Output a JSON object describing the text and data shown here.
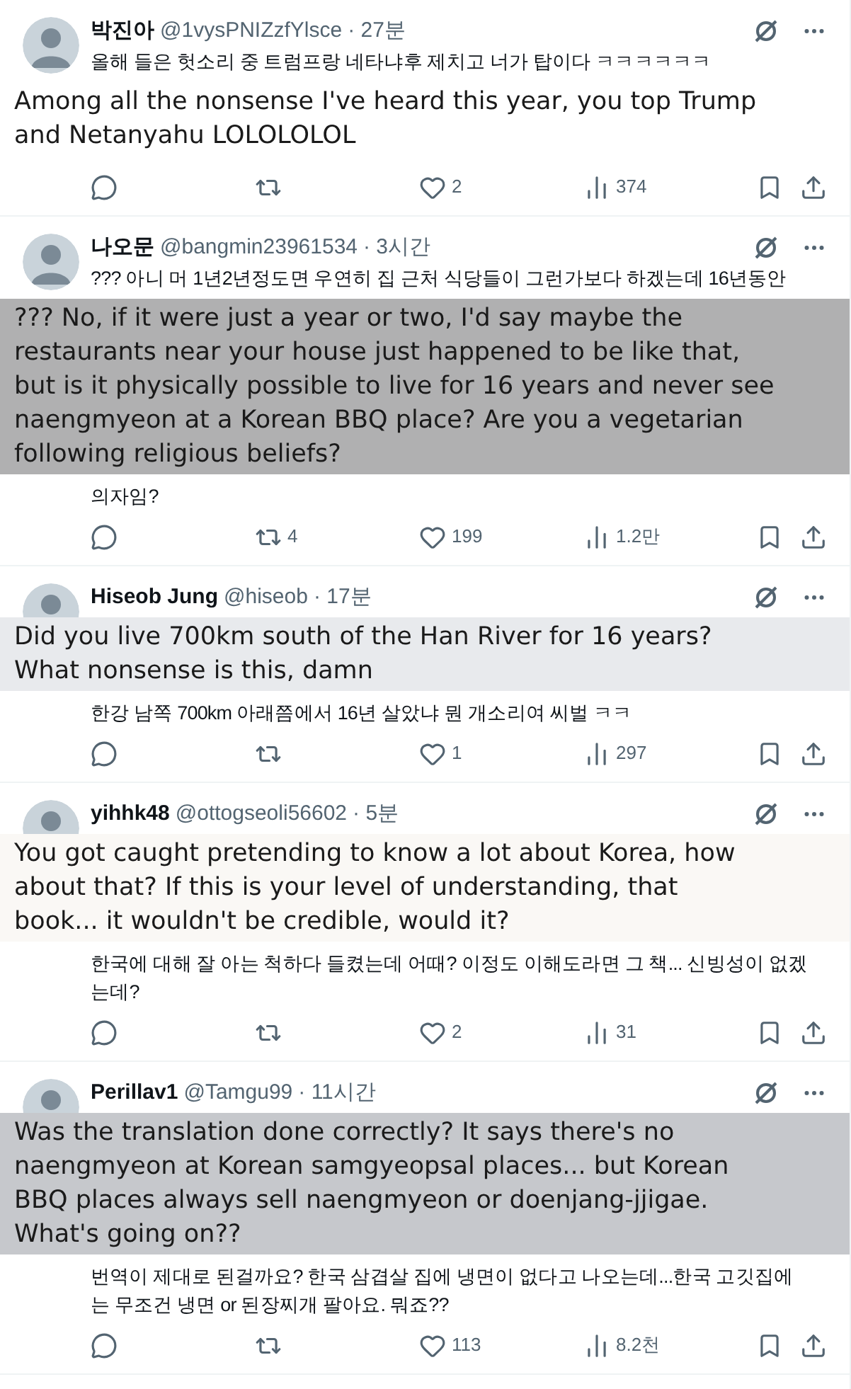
{
  "tweets": [
    {
      "name": "박진아",
      "handle": "@1vysPNIZzfYlsce",
      "time": "· 27분",
      "blocks": [
        {
          "kind": "text",
          "text": "올해 들은 헛소리 중 트럼프랑 네타냐후 제치고 너가 탑이다 ㅋㅋㅋㅋㅋㅋ"
        },
        {
          "kind": "translation",
          "color": "#ffffff",
          "text": "Among all the nonsense I've heard this year, you top Trump\nand Netanyahu LOLOLOLOL"
        }
      ],
      "actions": {
        "likes": "2",
        "views": "374"
      }
    },
    {
      "name": "나오문",
      "handle": "@bangmin23961534",
      "time": "· 3시간",
      "blocks": [
        {
          "kind": "text",
          "text": "??? 아니 머 1년2년정도면 우연히 집 근처 식당들이 그런가보다 하겠는데 16년동안"
        },
        {
          "kind": "translation",
          "color": "#b0b0b1",
          "text": "??? No, if it were just a year or two, I'd say maybe the\nrestaurants near your house just happened to be like that,\nbut is it physically possible to live for 16 years and never see\nnaengmyeon at a Korean BBQ place? Are you a vegetarian\nfollowing religious beliefs?"
        },
        {
          "kind": "text",
          "text": "의자임?"
        }
      ],
      "actions": {
        "reposts": "4",
        "likes": "199",
        "views": "1.2만"
      }
    },
    {
      "name": "Hiseob Jung",
      "handle": "@hiseob",
      "time": "· 17분",
      "blocks": [
        {
          "kind": "translation",
          "color": "#e8eaed",
          "text": "Did you live 700km south of the Han River for 16 years?\nWhat nonsense is this, damn"
        },
        {
          "kind": "text",
          "text": "한강 남쪽 700km 아래쯤에서 16년 살았냐 뭔 개소리여 씨벌 ㅋㅋ"
        }
      ],
      "actions": {
        "likes": "1",
        "views": "297"
      }
    },
    {
      "name": "yihhk48",
      "handle": "@ottogseoli56602",
      "time": "· 5분",
      "blocks": [
        {
          "kind": "translation",
          "color": "#faf8f5",
          "text": "You got caught pretending to know a lot about Korea, how\nabout that? If this is your level of understanding, that\nbook... it wouldn't be credible, would it?"
        },
        {
          "kind": "text",
          "text": "한국에 대해 잘 아는 척하다 들켰는데 어때? 이정도 이해도라면 그 책... 신빙성이 없겠\n는데?"
        }
      ],
      "actions": {
        "likes": "2",
        "views": "31"
      }
    },
    {
      "name": "Perillav1",
      "handle": "@Tamgu99",
      "time": "· 11시간",
      "blocks": [
        {
          "kind": "translation",
          "color": "#c6c8cc",
          "text": "Was the translation done correctly? It says there's no\nnaengmyeon at Korean samgyeopsal places... but Korean\nBBQ places always sell naengmyeon or doenjang-jjigae.\nWhat's going on??"
        },
        {
          "kind": "text",
          "text": "번역이 제대로 된걸까요? 한국 삼겹살 집에 냉면이 없다고 나오는데...한국 고깃집에\n는 무조건 냉면 or 된장찌개 팔아요. 뭐죠??"
        }
      ],
      "actions": {
        "likes": "113",
        "views": "8.2천"
      }
    }
  ]
}
